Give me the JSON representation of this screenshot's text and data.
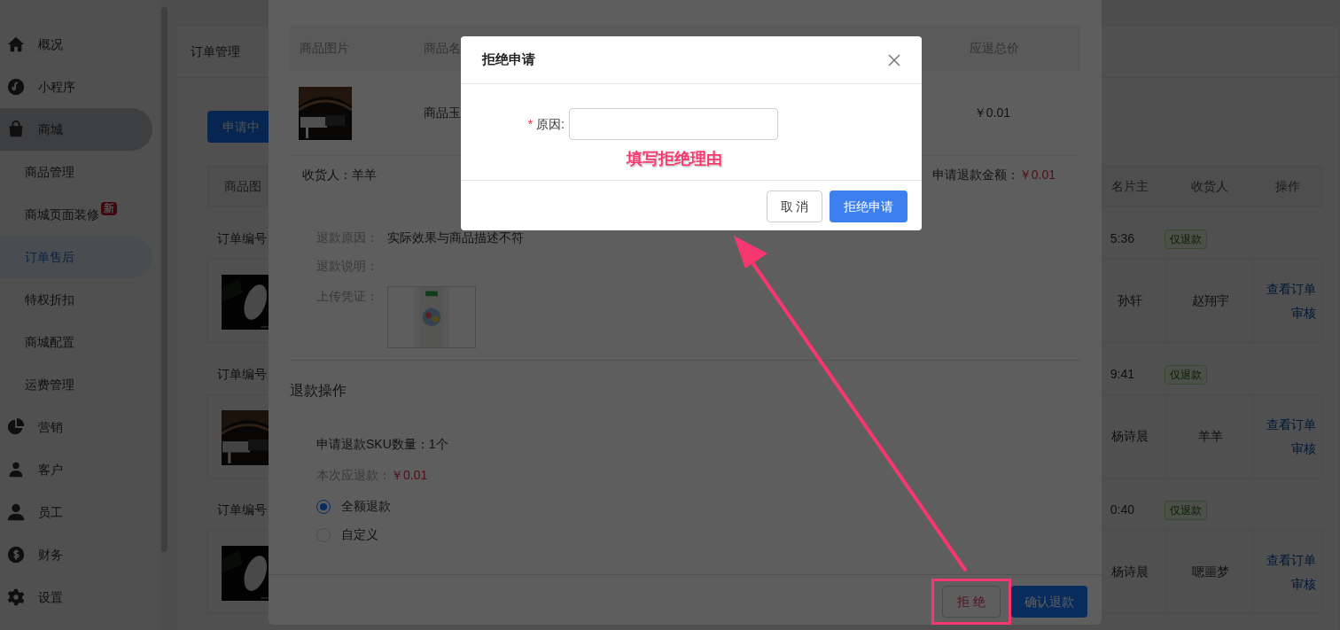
{
  "sidebar": {
    "items": [
      {
        "label": "概况",
        "selected": false
      },
      {
        "label": "小程序",
        "selected": false
      },
      {
        "label": "商城",
        "selected": true,
        "children": [
          {
            "label": "商品管理",
            "selected": false
          },
          {
            "label": "商城页面装修",
            "selected": false,
            "badge": "新"
          },
          {
            "label": "订单售后",
            "selected": true
          },
          {
            "label": "特权折扣",
            "selected": false
          },
          {
            "label": "商城配置",
            "selected": false
          },
          {
            "label": "运费管理",
            "selected": false
          }
        ]
      },
      {
        "label": "营销",
        "selected": false
      },
      {
        "label": "客户",
        "selected": false
      },
      {
        "label": "员工",
        "selected": false
      },
      {
        "label": "财务",
        "selected": false
      },
      {
        "label": "设置",
        "selected": false
      }
    ]
  },
  "page": {
    "title": "订单管理",
    "tabs": [
      {
        "label": "申请中",
        "selected": true
      }
    ],
    "table": {
      "columns": [
        "商品图",
        "名片主",
        "收货人",
        "操作"
      ],
      "orders": [
        {
          "label": "订单编号",
          "time": "5:36",
          "tag": "仅退款",
          "cells": [
            "孙轩",
            "赵翔宇"
          ],
          "actions": [
            "查看订单",
            "审核"
          ]
        },
        {
          "label": "订单编号",
          "time": "9:41",
          "tag": "仅退款",
          "cells": [
            "杨诗晨",
            "羊羊"
          ],
          "actions": [
            "查看订单",
            "审核"
          ]
        },
        {
          "label": "订单编号",
          "time": "0:40",
          "tag": "仅退款",
          "cells": [
            "杨诗晨",
            "嗯噩梦"
          ],
          "actions": [
            "查看订单",
            "审核"
          ]
        }
      ]
    }
  },
  "drawer": {
    "goods_table": {
      "columns": [
        "商品图片",
        "商品名",
        "应退总价"
      ],
      "rows": [
        {
          "name": "商品玉",
          "total": "￥0.01"
        }
      ]
    },
    "consignee_label": "收货人：",
    "consignee": "羊羊",
    "refund_amount_label": "申请退款金额：",
    "refund_amount": "￥0.01",
    "details": [
      {
        "label": "退款原因：",
        "value": "实际效果与商品描述不符"
      },
      {
        "label": "退款说明："
      },
      {
        "label": "上传凭证：",
        "kind": "picture"
      }
    ],
    "section_title": "退款操作",
    "sku_line": "申请退款SKU数量：1个",
    "due_label": "本次应退款：",
    "due": "￥0.01",
    "options": [
      {
        "label": "全额退款",
        "selected": true
      },
      {
        "label": "自定义",
        "selected": false
      }
    ],
    "buttons": [
      {
        "label": "拒 绝",
        "kind": "default",
        "highlighted": true
      },
      {
        "label": "确认退款",
        "kind": "primary",
        "highlighted": false
      }
    ]
  },
  "dialog": {
    "title": "拒绝申请",
    "field": {
      "label": "原因:",
      "required_mark": "*"
    },
    "annotation": "填写拒绝理由",
    "buttons": [
      {
        "label": "取 消",
        "kind": "default"
      },
      {
        "label": "拒绝申请",
        "kind": "primary"
      }
    ]
  }
}
